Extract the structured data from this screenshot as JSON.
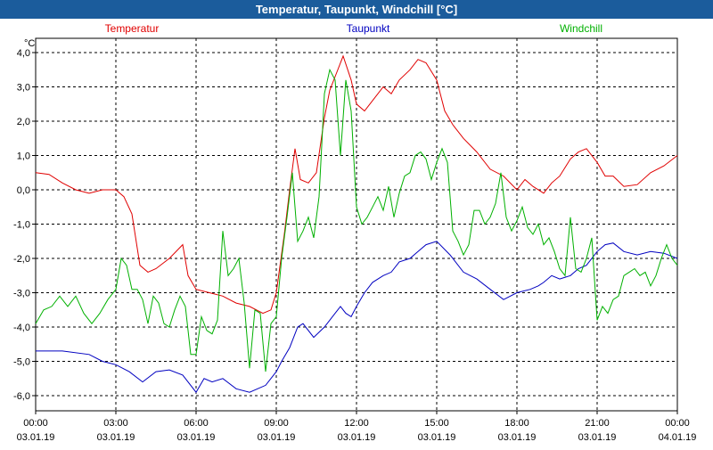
{
  "window": {
    "title": "Temperatur, Taupunkt, Windchill [°C]"
  },
  "chart_data": {
    "type": "line",
    "title": "Temperatur, Taupunkt, Windchill [°C]",
    "ylabel": "°C",
    "xlabel": "",
    "ylim": [
      -6.5,
      4.4
    ],
    "xlim": [
      0,
      24
    ],
    "grid": true,
    "legend_placement": "top",
    "y_ticks": [
      "4,0",
      "3,0",
      "2,0",
      "1,0",
      "0,0",
      "-1,0",
      "-2,0",
      "-3,0",
      "-4,0",
      "-5,0",
      "-6,0"
    ],
    "x_ticks": [
      {
        "time": "00:00",
        "date": "03.01.19"
      },
      {
        "time": "03:00",
        "date": "03.01.19"
      },
      {
        "time": "06:00",
        "date": "03.01.19"
      },
      {
        "time": "09:00",
        "date": "03.01.19"
      },
      {
        "time": "12:00",
        "date": "03.01.19"
      },
      {
        "time": "15:00",
        "date": "03.01.19"
      },
      {
        "time": "18:00",
        "date": "03.01.19"
      },
      {
        "time": "21:00",
        "date": "03.01.19"
      },
      {
        "time": "00:00",
        "date": "04.01.19"
      }
    ],
    "series": [
      {
        "name": "Temperatur",
        "color": "#e00000",
        "x": [
          0,
          0.5,
          1,
          1.5,
          2,
          2.5,
          3,
          3.3,
          3.6,
          3.9,
          4.2,
          4.5,
          5,
          5.5,
          5.7,
          6,
          6.5,
          7,
          7.5,
          8,
          8.5,
          8.8,
          9,
          9.3,
          9.5,
          9.7,
          9.9,
          10.2,
          10.5,
          10.8,
          11,
          11.2,
          11.5,
          11.8,
          12,
          12.3,
          12.6,
          13,
          13.3,
          13.6,
          14,
          14.3,
          14.6,
          15,
          15.3,
          15.6,
          16,
          16.5,
          17,
          17.5,
          18,
          18.3,
          18.6,
          19,
          19.3,
          19.6,
          20,
          20.3,
          20.6,
          21,
          21.3,
          21.6,
          22,
          22.5,
          23,
          23.5,
          24
        ],
        "values": [
          0.5,
          0.45,
          0.2,
          0.0,
          -0.1,
          0.0,
          0.0,
          -0.2,
          -0.7,
          -2.2,
          -2.4,
          -2.3,
          -2.0,
          -1.6,
          -2.5,
          -2.9,
          -3.0,
          -3.1,
          -3.3,
          -3.4,
          -3.6,
          -3.5,
          -3.0,
          -1.3,
          0.0,
          1.2,
          0.3,
          0.2,
          0.5,
          2.1,
          2.9,
          3.3,
          3.9,
          3.2,
          2.5,
          2.3,
          2.6,
          3.0,
          2.8,
          3.2,
          3.5,
          3.8,
          3.7,
          3.2,
          2.3,
          1.9,
          1.5,
          1.1,
          0.6,
          0.4,
          0.0,
          0.3,
          0.1,
          -0.1,
          0.2,
          0.4,
          0.9,
          1.1,
          1.2,
          0.8,
          0.4,
          0.4,
          0.1,
          0.15,
          0.5,
          0.7,
          1.0
        ]
      },
      {
        "name": "Taupunkt",
        "color": "#0000c0",
        "x": [
          0,
          1,
          2,
          2.5,
          3,
          3.5,
          4,
          4.5,
          5,
          5.5,
          6,
          6.3,
          6.6,
          7,
          7.5,
          8,
          8.3,
          8.6,
          9,
          9.2,
          9.5,
          9.8,
          10,
          10.4,
          10.8,
          11,
          11.2,
          11.4,
          11.6,
          11.8,
          12,
          12.3,
          12.6,
          13,
          13.3,
          13.6,
          14,
          14.3,
          14.6,
          15,
          15.5,
          16,
          16.5,
          17,
          17.5,
          18,
          18.5,
          18.8,
          19,
          19.3,
          19.6,
          20,
          20.3,
          20.6,
          21,
          21.3,
          21.6,
          22,
          22.5,
          23,
          23.5,
          24
        ],
        "values": [
          -4.7,
          -4.7,
          -4.8,
          -5.0,
          -5.1,
          -5.3,
          -5.6,
          -5.3,
          -5.25,
          -5.4,
          -5.9,
          -5.5,
          -5.6,
          -5.5,
          -5.8,
          -5.9,
          -5.8,
          -5.7,
          -5.3,
          -5.0,
          -4.6,
          -4.0,
          -3.9,
          -4.3,
          -4.0,
          -3.8,
          -3.6,
          -3.4,
          -3.6,
          -3.7,
          -3.4,
          -3.0,
          -2.7,
          -2.5,
          -2.4,
          -2.1,
          -2.0,
          -1.8,
          -1.6,
          -1.5,
          -1.9,
          -2.4,
          -2.6,
          -2.9,
          -3.2,
          -3.0,
          -2.9,
          -2.8,
          -2.7,
          -2.5,
          -2.6,
          -2.5,
          -2.3,
          -2.2,
          -1.8,
          -1.6,
          -1.55,
          -1.8,
          -1.9,
          -1.8,
          -1.85,
          -2.0
        ]
      },
      {
        "name": "Windchill",
        "color": "#00b000",
        "x": [
          0,
          0.3,
          0.6,
          0.9,
          1.2,
          1.5,
          1.8,
          2.1,
          2.4,
          2.7,
          3.0,
          3.2,
          3.4,
          3.6,
          3.8,
          4.0,
          4.2,
          4.4,
          4.6,
          4.8,
          5.0,
          5.2,
          5.4,
          5.6,
          5.8,
          6.0,
          6.2,
          6.4,
          6.6,
          6.8,
          7.0,
          7.2,
          7.4,
          7.6,
          7.8,
          8.0,
          8.2,
          8.4,
          8.6,
          8.8,
          9.0,
          9.2,
          9.4,
          9.6,
          9.8,
          10.0,
          10.2,
          10.4,
          10.6,
          10.8,
          11.0,
          11.2,
          11.4,
          11.6,
          11.8,
          12.0,
          12.2,
          12.4,
          12.6,
          12.8,
          13.0,
          13.2,
          13.4,
          13.6,
          13.8,
          14.0,
          14.2,
          14.4,
          14.6,
          14.8,
          15.0,
          15.2,
          15.4,
          15.6,
          15.8,
          16.0,
          16.2,
          16.4,
          16.6,
          16.8,
          17.0,
          17.2,
          17.4,
          17.6,
          17.8,
          18.0,
          18.2,
          18.4,
          18.6,
          18.8,
          19.0,
          19.2,
          19.4,
          19.6,
          19.8,
          20.0,
          20.2,
          20.4,
          20.6,
          20.8,
          21.0,
          21.2,
          21.4,
          21.6,
          21.8,
          22.0,
          22.2,
          22.4,
          22.6,
          22.8,
          23.0,
          23.2,
          23.4,
          23.6,
          23.8,
          24.0
        ],
        "values": [
          -3.9,
          -3.5,
          -3.4,
          -3.1,
          -3.4,
          -3.1,
          -3.6,
          -3.9,
          -3.6,
          -3.2,
          -2.9,
          -2.0,
          -2.2,
          -2.9,
          -2.9,
          -3.2,
          -3.9,
          -3.1,
          -3.3,
          -3.9,
          -4.0,
          -3.5,
          -3.1,
          -3.4,
          -4.8,
          -4.8,
          -3.7,
          -4.1,
          -4.2,
          -3.8,
          -1.2,
          -2.5,
          -2.3,
          -2.0,
          -3.3,
          -5.2,
          -3.5,
          -3.6,
          -5.3,
          -3.9,
          -3.7,
          -2.0,
          -0.8,
          0.5,
          -1.5,
          -1.2,
          -0.8,
          -1.4,
          -0.2,
          2.8,
          3.5,
          3.2,
          1.0,
          3.2,
          2.3,
          -0.5,
          -1.0,
          -0.8,
          -0.5,
          -0.2,
          -0.6,
          0.1,
          -0.8,
          -0.1,
          0.4,
          0.5,
          1.0,
          1.1,
          0.9,
          0.3,
          0.8,
          1.2,
          0.8,
          -1.2,
          -1.5,
          -1.9,
          -1.6,
          -0.6,
          -0.6,
          -1.0,
          -0.8,
          -0.4,
          0.5,
          -0.8,
          -1.2,
          -0.9,
          -0.5,
          -1.1,
          -1.3,
          -1.0,
          -1.6,
          -1.4,
          -1.8,
          -2.3,
          -2.5,
          -0.8,
          -2.3,
          -2.4,
          -2.0,
          -1.4,
          -3.8,
          -3.4,
          -3.6,
          -3.2,
          -3.1,
          -2.5,
          -2.4,
          -2.3,
          -2.5,
          -2.4,
          -2.8,
          -2.5,
          -2.0,
          -1.6,
          -2.0,
          -2.2
        ]
      }
    ]
  }
}
